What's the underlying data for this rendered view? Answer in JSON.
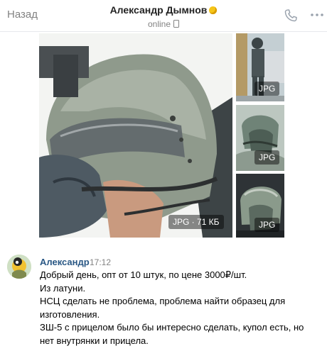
{
  "header": {
    "back_label": "Назад",
    "title": "Александр Дымнов",
    "status": "online"
  },
  "attachments": {
    "main_badge": "JPG · 71 КБ",
    "thumb_badges": [
      "JPG",
      "JPG",
      "JPG"
    ]
  },
  "message": {
    "author": "Александр",
    "time": "17:12",
    "lines": [
      "Добрый день, опт от 10 штук, по цене 3000₽/шт.",
      "Из латуни.",
      "НСЦ сделать не проблема, проблема найти образец для",
      "изготовления.",
      "ЗШ-5 с прицелом было бы интересно сделать, купол есть, но",
      "нет внутрянки и прицела."
    ]
  },
  "colors": {
    "link": "#2a5885",
    "muted": "#828282",
    "helmet": "#8f9a8c"
  },
  "icons": [
    "phone-icon",
    "more-icon",
    "mobile-icon",
    "emoji-icon"
  ]
}
